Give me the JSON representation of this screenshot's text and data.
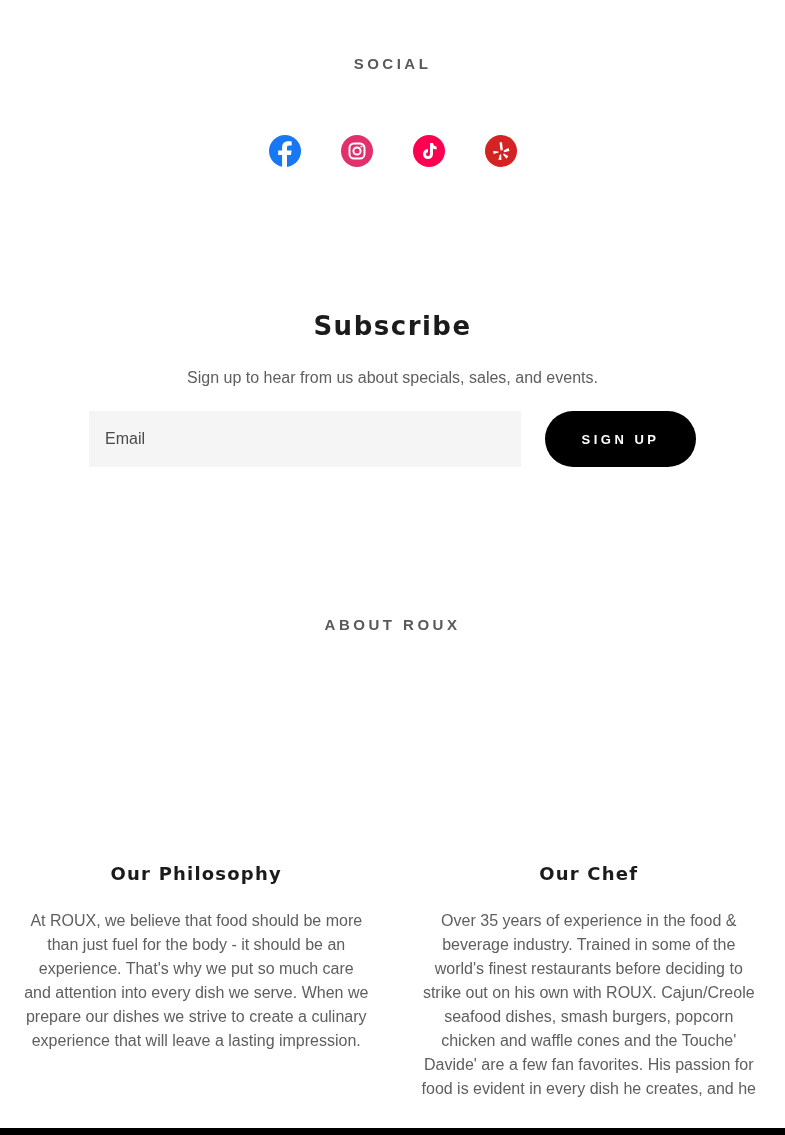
{
  "social": {
    "heading": "SOCIAL"
  },
  "subscribe": {
    "title": "Subscribe",
    "text": "Sign up to hear from us about specials, sales, and events.",
    "email": {
      "placeholder": "Email"
    },
    "button": "SIGN UP"
  },
  "about": {
    "heading": "ABOUT ROUX",
    "columns": [
      {
        "title": "Our Philosophy",
        "text": "At ROUX, we believe that food should be more than just fuel for the body - it should be an experience. That's why we put so much care and attention into every dish we serve. When we prepare our dishes we strive to create a culinary experience that will leave a lasting impression."
      },
      {
        "title": "Our Chef",
        "text": "Over 35 years of experience in the food & beverage industry. Trained in some of the world's finest restaurants before deciding to strike out on his own with ROUX. Cajun/Creole seafood dishes, smash burgers, popcorn chicken and waffle cones and the Touche' Davide' are a few fan favorites. His passion for food is evident in every dish he creates, and he"
      }
    ]
  }
}
